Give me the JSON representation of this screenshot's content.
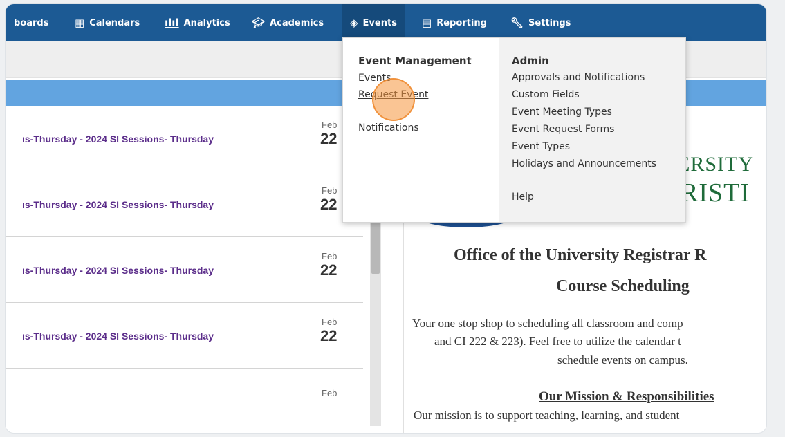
{
  "nav": {
    "items": [
      {
        "label": "boards",
        "icon": ""
      },
      {
        "label": "Calendars",
        "icon": "calendar-icon"
      },
      {
        "label": "Analytics",
        "icon": "bar-chart-icon"
      },
      {
        "label": "Academics",
        "icon": "graduation-cap-icon"
      },
      {
        "label": "Events",
        "icon": "tag-icon"
      },
      {
        "label": "Reporting",
        "icon": "document-icon"
      },
      {
        "label": "Settings",
        "icon": "wrench-icon"
      }
    ]
  },
  "dropdown": {
    "left_header": "Event Management",
    "left_links": [
      "Events",
      "Request Event",
      "Notifications"
    ],
    "right_header": "Admin",
    "right_links": [
      "Approvals and Notifications",
      "Custom Fields",
      "Event Meeting Types",
      "Event Request Forms",
      "Event Types",
      "Holidays and Announcements"
    ],
    "help": "Help"
  },
  "events_list": [
    {
      "title": "ıs-Thursday - 2024 SI Sessions- Thursday",
      "month": "Feb",
      "day": "22"
    },
    {
      "title": "ıs-Thursday - 2024 SI Sessions- Thursday",
      "month": "Feb",
      "day": "22"
    },
    {
      "title": "ıs-Thursday - 2024 SI Sessions- Thursday",
      "month": "Feb",
      "day": "22"
    },
    {
      "title": "ıs-Thursday - 2024 SI Sessions- Thursday",
      "month": "Feb",
      "day": "22"
    },
    {
      "title": "",
      "month": "Feb",
      "day": ""
    }
  ],
  "content": {
    "logo_line1": "ERSITY",
    "logo_line2": "RISTI",
    "title": "Office of the University Registrar R",
    "subtitle": "Course Scheduling",
    "para_lines": [
      "Your one stop shop to scheduling all classroom and comp",
      "and CI 222 & 223).  Feel free to utilize the calendar t",
      "schedule events on campus."
    ],
    "mission_heading": "Our Mission & Responsibilities",
    "mission_text": "Our mission is to support teaching, learning, and student"
  },
  "colors": {
    "nav": "#1c5a94",
    "accent_bar": "#62a4e0",
    "event_title": "#5b2d8a",
    "logo_green": "#1f6b3a"
  }
}
